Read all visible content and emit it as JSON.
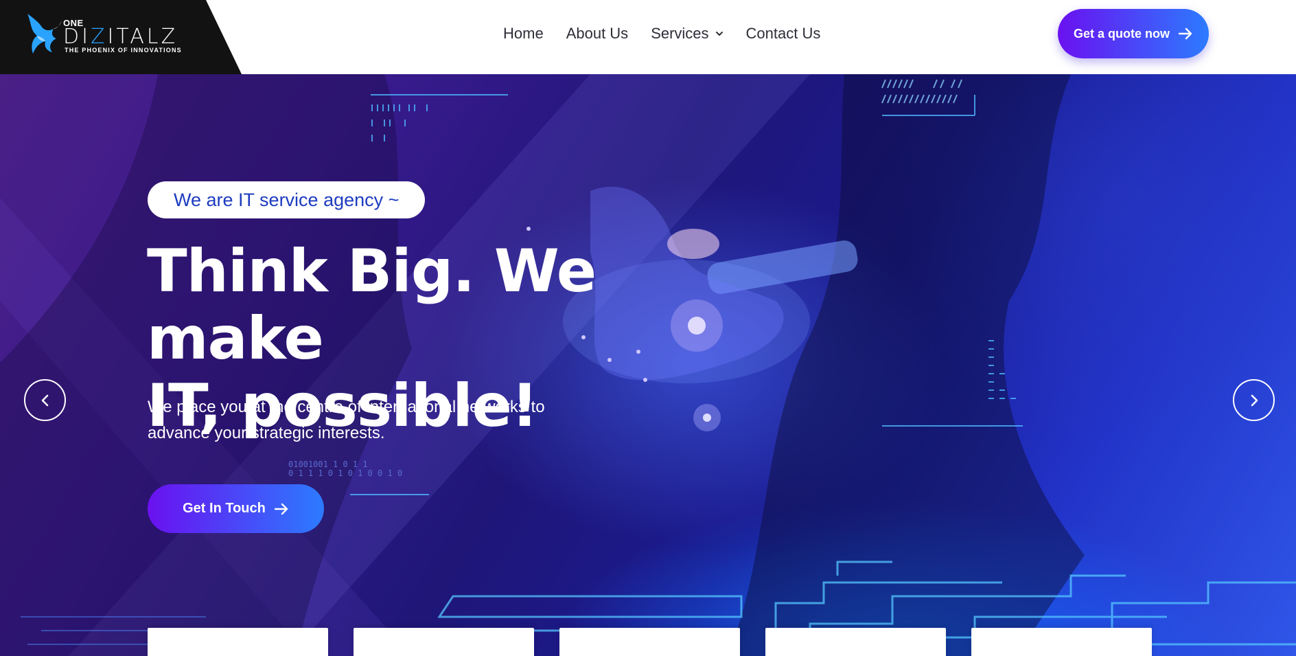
{
  "brand": {
    "prefix": "ONE",
    "name_part1": "DI",
    "name_accent": "Z",
    "name_part2": "ITALZ",
    "tagline": "THE PHOENIX OF INNOVATIONS",
    "logo_icon": "phoenix-icon",
    "accent_color": "#2aa3ff"
  },
  "nav": {
    "items": [
      {
        "label": "Home"
      },
      {
        "label": "About Us"
      },
      {
        "label": "Services",
        "icon": "chevron-down-icon"
      },
      {
        "label": "Contact Us"
      }
    ]
  },
  "header": {
    "quote_label": "Get a quote now",
    "quote_icon": "arrow-right-icon"
  },
  "hero": {
    "badge": "We are IT service agency ~",
    "headline_line1": "Think Big. We make",
    "headline_line2": "IT, possible!",
    "subtext_line1": "We place you at the centre of international networks to",
    "subtext_line2": "advance your strategic interests.",
    "cta_label": "Get In Touch",
    "cta_icon": "arrow-right-icon",
    "prev_icon": "chevron-left-icon",
    "next_icon": "chevron-right-icon",
    "binary_line1": "01001001 1 0 1 1",
    "binary_line2": "0 1 1 1 0 1 0 1 0 0 1 0"
  },
  "colors": {
    "button_gradient_start": "#6a11f0",
    "button_gradient_end": "#2c7bff",
    "badge_text": "#1d3bbf",
    "nav_text": "#2e2e38"
  }
}
